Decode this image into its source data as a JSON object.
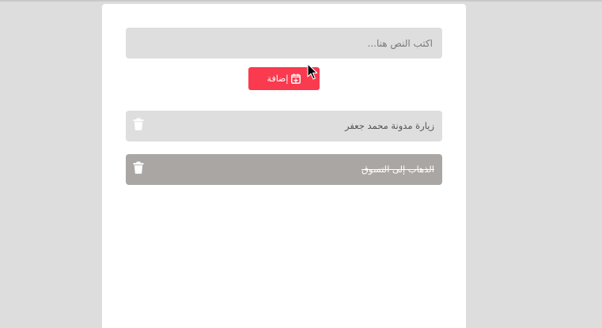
{
  "input": {
    "placeholder": "اكتب النص هنا...",
    "value": ""
  },
  "add_button": {
    "label": "إضافة",
    "icon": "calendar-plus-icon",
    "color": "#fa3a4f"
  },
  "todos": [
    {
      "text": "زيارة مدونة محمد جعفر",
      "completed": false,
      "delete_icon": "trash-icon"
    },
    {
      "text": "الذهاب إلى التسوق",
      "completed": true,
      "delete_icon": "trash-icon"
    }
  ],
  "colors": {
    "background": "#dddddd",
    "card": "#ffffff",
    "item": "#dedede",
    "item_completed": "#aaa6a4"
  }
}
